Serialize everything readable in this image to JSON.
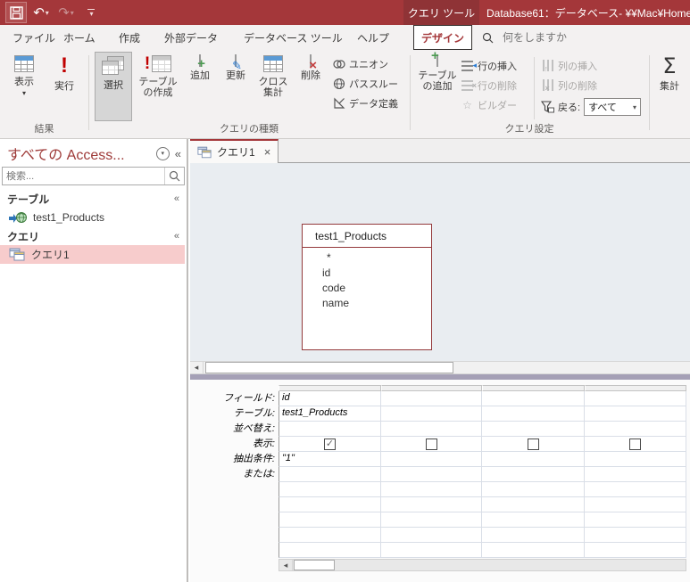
{
  "titlebar": {
    "contextual_label": "クエリ ツール",
    "title": "Database61：データベース- ¥¥Mac¥Home¥"
  },
  "tabs": {
    "items": [
      {
        "label": "ファイル"
      },
      {
        "label": "ホーム"
      },
      {
        "label": "作成"
      },
      {
        "label": "外部データ"
      },
      {
        "label": "データベース ツール"
      },
      {
        "label": "ヘルプ"
      },
      {
        "label": "デザイン",
        "active": true
      }
    ]
  },
  "search": {
    "placeholder": "何をしますか"
  },
  "ribbon": {
    "groups": {
      "results": "結果",
      "query_type": "クエリの種類",
      "query_setup": "クエリ設定"
    },
    "view": "表示",
    "run": "実行",
    "select": "選択",
    "make_table": "テーブルの作成",
    "append": "追加",
    "update": "更新",
    "crosstab": "クロス集計",
    "delete_q": "削除",
    "union": "ユニオン",
    "passthrough": "パススルー",
    "data_definition": "データ定義",
    "add_tables": "テーブルの追加",
    "insert_rows": "行の挿入",
    "delete_rows": "行の削除",
    "builder": "ビルダー",
    "insert_columns": "列の挿入",
    "delete_columns": "列の削除",
    "return_label": "戻る:",
    "return_value": "すべて",
    "totals": "集計"
  },
  "nav": {
    "header": "すべての Access...",
    "search_placeholder": "検索...",
    "sections": {
      "tables": {
        "label": "テーブル",
        "items": [
          {
            "label": "test1_Products",
            "icon": "linked-web-table-icon"
          }
        ]
      },
      "queries": {
        "label": "クエリ",
        "items": [
          {
            "label": "クエリ1",
            "icon": "query-icon",
            "selected": true
          }
        ]
      }
    }
  },
  "doc": {
    "tab_label": "クエリ1",
    "table_box": {
      "title": "test1_Products",
      "fields": [
        "*",
        "id",
        "code",
        "name"
      ]
    },
    "grid": {
      "row_labels": [
        "フィールド:",
        "テーブル:",
        "並べ替え:",
        "表示:",
        "抽出条件:",
        "または:"
      ],
      "columns": [
        {
          "field": "id",
          "table": "test1_Products",
          "sort": "",
          "show": true,
          "criteria": "\"1\""
        },
        {
          "field": "",
          "table": "",
          "sort": "",
          "show": false,
          "criteria": ""
        },
        {
          "field": "",
          "table": "",
          "sort": "",
          "show": false,
          "criteria": ""
        },
        {
          "field": "",
          "table": "",
          "sort": "",
          "show": false,
          "criteria": ""
        }
      ]
    }
  },
  "glyphs": {
    "dropdown": "▾",
    "collapse_pane": "«",
    "collapse_section": "«",
    "check": "✓",
    "sigma": "Σ",
    "exclaim": "!",
    "plus": "+",
    "cross": "×",
    "pencil": "✎",
    "star": "☆",
    "arrow_left": "◂",
    "arrow_up": "↑",
    "undo": "↶",
    "redo": "↷",
    "close": "×"
  },
  "colors": {
    "titlebar": "#A4373A",
    "contextual_tab": "#8F3336",
    "ribbon_bg": "#F3F1F1",
    "selected_nav_item": "#F7CCCC",
    "design_surface": "#E9EDF1",
    "table_box_border": "#94393B",
    "splitter": "#A5A0B6",
    "accent_red": "#C00000",
    "accent_green": "#4C9A52",
    "accent_blue": "#2B7CD3"
  }
}
